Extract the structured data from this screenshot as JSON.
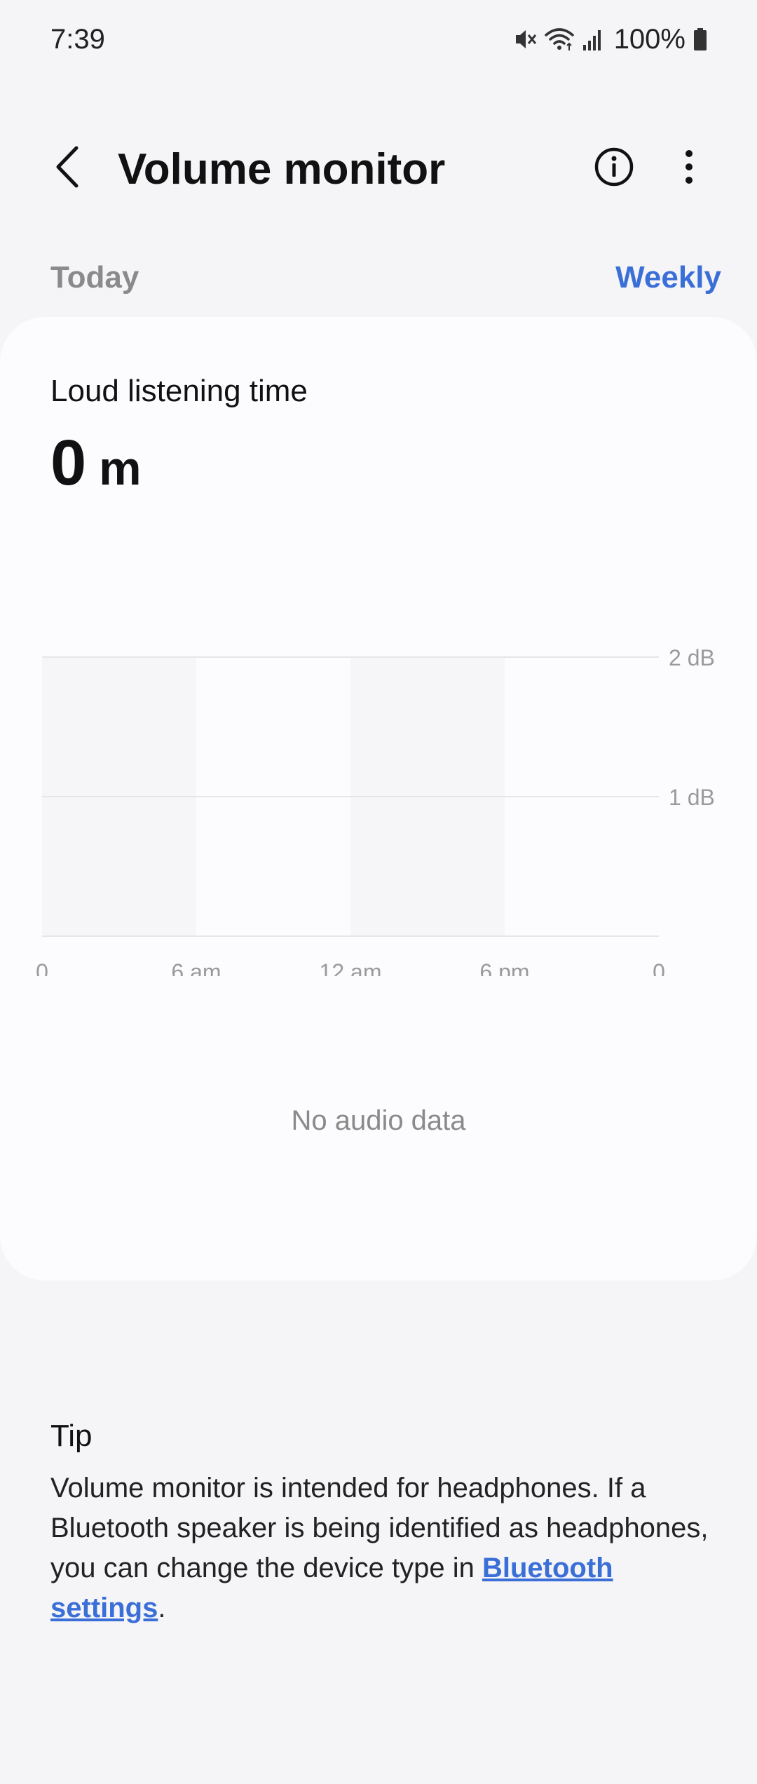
{
  "status_bar": {
    "time": "7:39",
    "battery_percent": "100%",
    "icons": [
      "mute-icon",
      "wifi-icon",
      "signal-icon",
      "battery-icon"
    ]
  },
  "header": {
    "title": "Volume monitor",
    "back_icon": "back-arrow-icon",
    "info_icon": "info-icon",
    "more_icon": "more-options-icon"
  },
  "tabs": {
    "today": "Today",
    "weekly": "Weekly",
    "selected": "Today"
  },
  "card": {
    "label": "Loud listening time",
    "value_number": "0",
    "value_unit": "m",
    "empty_message": "No audio data"
  },
  "chart_data": {
    "type": "bar",
    "categories": [
      "0",
      "6 am",
      "12 am",
      "6 pm",
      "0"
    ],
    "x_tick_labels": [
      "0",
      "6 am",
      "12 am",
      "6 pm",
      "0"
    ],
    "y_tick_labels": [
      "2 dB",
      "1 dB"
    ],
    "y_ticks": [
      2,
      1
    ],
    "ylim": [
      0,
      2
    ],
    "series": [],
    "grid": true,
    "title": "",
    "xlabel": "",
    "ylabel": ""
  },
  "tip": {
    "title": "Tip",
    "body_text": "Volume monitor is intended for headphones. If a Bluetooth speaker is being identified as headphones, you can change the device type in ",
    "link_text": "Bluetooth settings",
    "body_end": "."
  },
  "colors": {
    "accent": "#3a6fd8",
    "background": "#f5f4f7",
    "card": "#fcfcfe",
    "muted_text": "#8a8a8a"
  }
}
